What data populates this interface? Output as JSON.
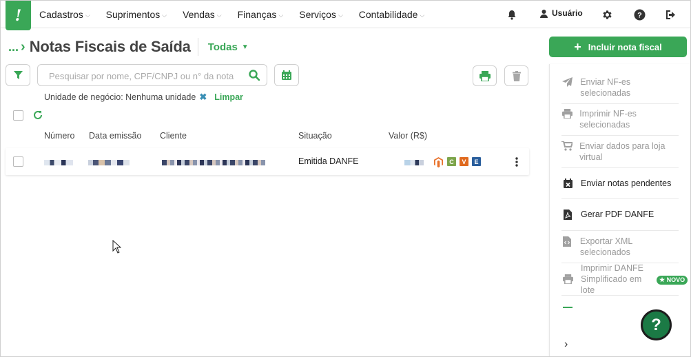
{
  "app": {
    "logo_glyph": "!",
    "brand_color": "#3aa757"
  },
  "nav": {
    "items": [
      {
        "label": "Cadastros"
      },
      {
        "label": "Suprimentos"
      },
      {
        "label": "Vendas"
      },
      {
        "label": "Finanças"
      },
      {
        "label": "Serviços"
      },
      {
        "label": "Contabilidade"
      }
    ],
    "user_label": "Usuário",
    "icons": [
      "bell-icon",
      "user-icon",
      "gear-icon",
      "help-icon",
      "logout-icon"
    ]
  },
  "header": {
    "breadcrumb": "...",
    "title": "Notas Fiscais de Saída",
    "filter_value": "Todas"
  },
  "toolbar": {
    "search_placeholder": "Pesquisar por nome, CPF/CNPJ ou n° da nota"
  },
  "filters": {
    "unit_text": "Unidade de negócio: Nenhuma unidade",
    "clear_label": "Limpar"
  },
  "table": {
    "columns": [
      "Número",
      "Data emissão",
      "Cliente",
      "Situação",
      "Valor (R$)"
    ],
    "rows": [
      {
        "status": "Emitida DANFE",
        "badges": [
          "C",
          "V",
          "E"
        ]
      }
    ]
  },
  "side": {
    "primary_button": "Incluir nota fiscal",
    "actions": [
      {
        "label": "Enviar NF-es selecionadas",
        "icon": "paper-plane-icon",
        "enabled": false
      },
      {
        "label": "Imprimir NF-es selecionadas",
        "icon": "printer-icon",
        "enabled": false
      },
      {
        "label": "Enviar dados para loja virtual",
        "icon": "cart-icon",
        "enabled": false
      },
      {
        "label": "Enviar notas pendentes",
        "icon": "calendar-x-icon",
        "enabled": true
      },
      {
        "label": "Gerar PDF DANFE",
        "icon": "pdf-icon",
        "enabled": true
      },
      {
        "label": "Exportar XML selecionados",
        "icon": "code-file-icon",
        "enabled": false
      },
      {
        "label": "Imprimir DANFE Simplificado em lote",
        "icon": "printer-icon",
        "enabled": false
      }
    ],
    "novo_badge": "★ NOVO",
    "help_fab": "?",
    "expand": "›"
  }
}
